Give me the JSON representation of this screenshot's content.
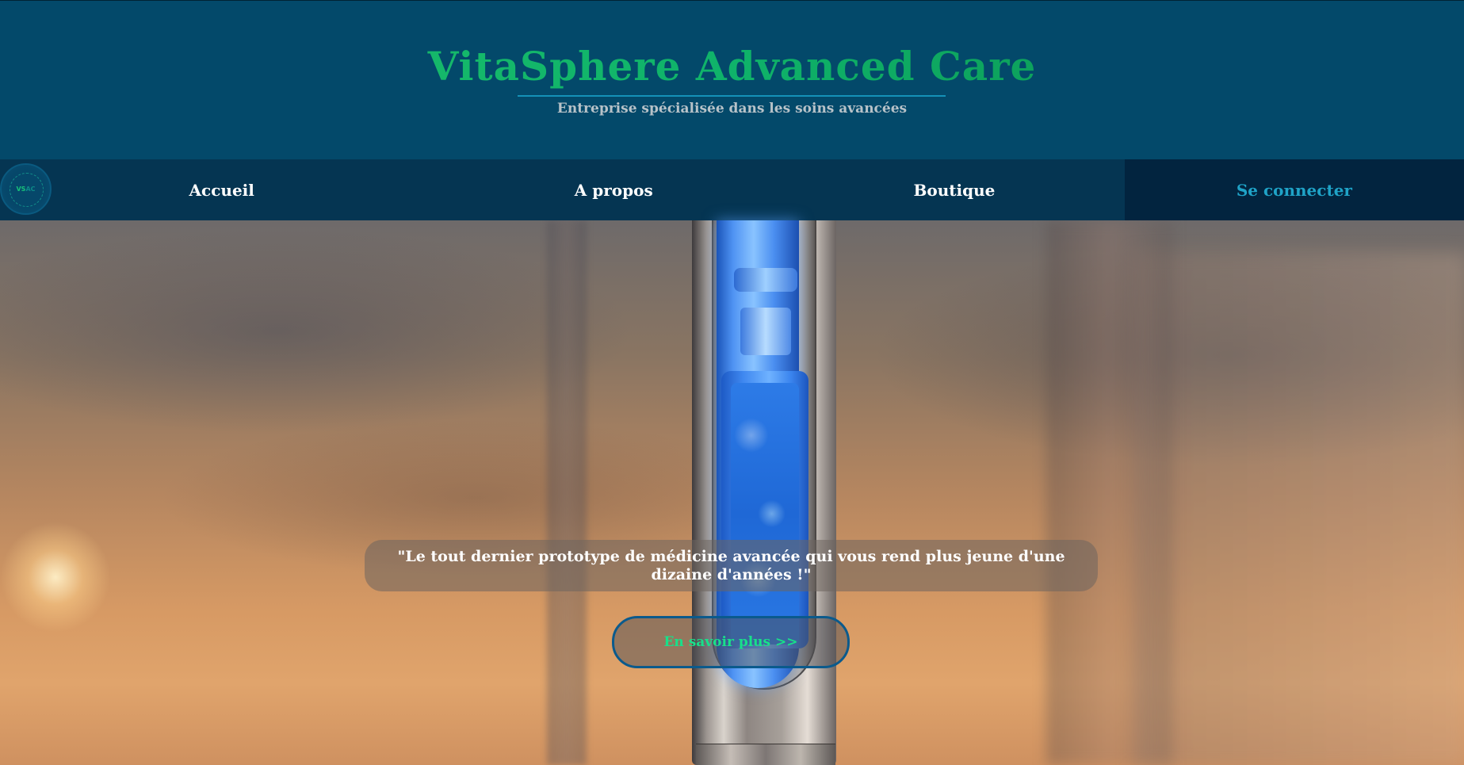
{
  "header": {
    "title": "VitaSphere Advanced Care",
    "subtitle": "Entreprise spécialisée dans les soins avancées"
  },
  "logo": {
    "text_vs": "VS",
    "text_ac": "AC"
  },
  "nav": {
    "items": [
      {
        "label": "Accueil"
      },
      {
        "label": "A propos"
      },
      {
        "label": "Boutique"
      },
      {
        "label": "Se connecter"
      }
    ]
  },
  "hero": {
    "tagline": "\"Le tout dernier prototype de médicine avancée qui vous rend plus jeune d'une dizaine d'années !\"",
    "cta_label": "En savoir plus >>"
  },
  "colors": {
    "header_bg": "#03496a",
    "nav_bg": "#053552",
    "login_bg": "#02243f",
    "login_text": "#1fa3c7",
    "title_green": "#1ec06a",
    "cta_text": "#18e08a"
  }
}
